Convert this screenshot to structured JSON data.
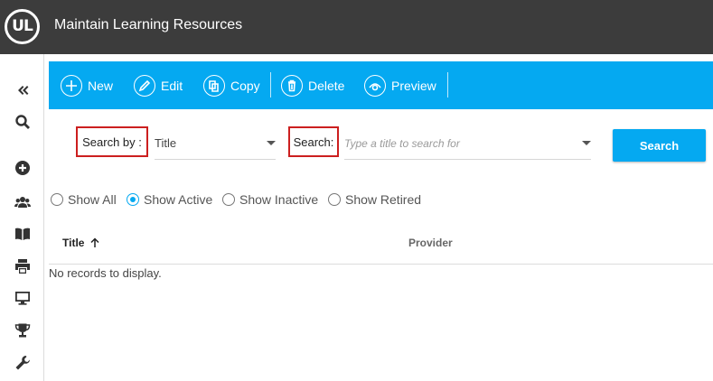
{
  "header": {
    "logo_text": "UL",
    "title": "Maintain Learning Resources"
  },
  "sidebar": {
    "items": [
      {
        "icon": "collapse-icon"
      },
      {
        "icon": "search-icon"
      },
      {
        "icon": "add-circle-icon"
      },
      {
        "icon": "users-icon"
      },
      {
        "icon": "book-icon"
      },
      {
        "icon": "print-icon"
      },
      {
        "icon": "monitor-icon"
      },
      {
        "icon": "trophy-icon"
      },
      {
        "icon": "wrench-icon"
      }
    ]
  },
  "toolbar": {
    "new_label": "New",
    "edit_label": "Edit",
    "copy_label": "Copy",
    "delete_label": "Delete",
    "preview_label": "Preview"
  },
  "search": {
    "search_by_label": "Search by :",
    "search_by_value": "Title",
    "search_label": "Search:",
    "placeholder": "Type a title to search for",
    "button_label": "Search"
  },
  "filters": {
    "options": [
      "Show All",
      "Show Active",
      "Show Inactive",
      "Show Retired"
    ],
    "selected": "Show Active"
  },
  "table": {
    "columns": [
      "Title",
      "Provider"
    ],
    "sort_column": "Title",
    "sort_direction": "ascending",
    "empty_message": "No records to display."
  },
  "colors": {
    "header_bg": "#3c3c3c",
    "accent": "#05a9f1",
    "highlight_border": "#cc1f1f"
  }
}
